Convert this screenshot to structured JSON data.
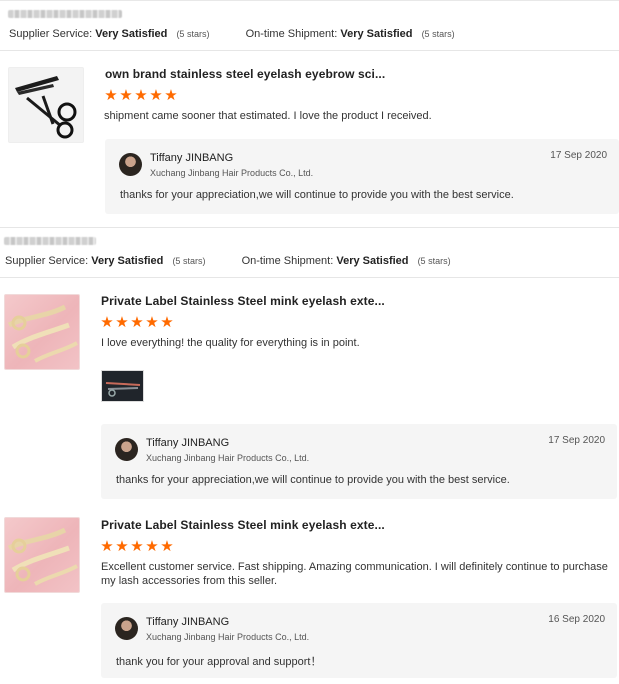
{
  "reviews": [
    {
      "supplier_service_label": "Supplier Service:",
      "supplier_service_value": "Very Satisfied",
      "supplier_service_stars": "(5 stars)",
      "shipment_label": "On-time Shipment:",
      "shipment_value": "Very Satisfied",
      "shipment_stars": "(5 stars)",
      "product_title": "own brand stainless steel eyelash eyebrow sci...",
      "rating": 5,
      "comment": "shipment came sooner that estimated. I love the product I received.",
      "reply": {
        "name": "Tiffany JINBANG",
        "company": "Xuchang Jinbang Hair Products Co., Ltd.",
        "date": "17 Sep 2020",
        "text": "thanks for your appreciation,we will continue to provide you with the best service."
      }
    },
    {
      "supplier_service_label": "Supplier Service:",
      "supplier_service_value": "Very Satisfied",
      "supplier_service_stars": "(5 stars)",
      "shipment_label": "On-time Shipment:",
      "shipment_value": "Very Satisfied",
      "shipment_stars": "(5 stars)",
      "product_title": "Private Label Stainless Steel mink eyelash exte...",
      "rating": 5,
      "comment": "I love everything! the quality for everything is in point.",
      "reply": {
        "name": "Tiffany JINBANG",
        "company": "Xuchang Jinbang Hair Products Co., Ltd.",
        "date": "17 Sep 2020",
        "text": "thanks for your appreciation,we will continue to provide you with the best service."
      }
    },
    {
      "product_title": "Private Label Stainless Steel mink eyelash exte...",
      "rating": 5,
      "comment_line1": "Excellent customer service. Fast shipping. Amazing communication. I will definitely continue to purchase",
      "comment_line2": "my lash accessories from this seller.",
      "reply": {
        "name": "Tiffany JINBANG",
        "company": "Xuchang Jinbang Hair Products Co., Ltd.",
        "date": "16 Sep 2020",
        "text": "thank you for your approval and support！"
      }
    }
  ],
  "icons": {
    "star": "star-icon",
    "avatar": "avatar"
  },
  "colors": {
    "star": "#ff6a00",
    "reply_bg": "#f5f5f5",
    "divider": "#e6e6e6",
    "thumb_pink": "#f0bcc0"
  }
}
